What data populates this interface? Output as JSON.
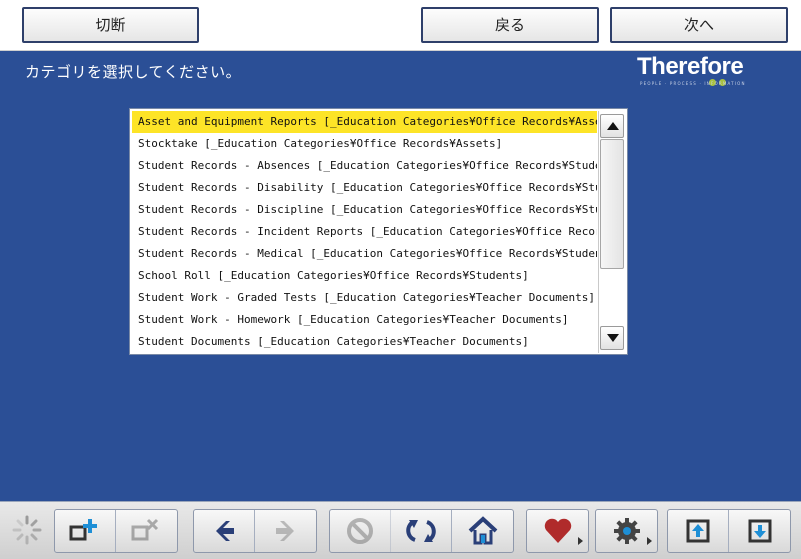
{
  "header": {
    "disconnect_label": "切断",
    "back_label": "戻る",
    "next_label": "次へ"
  },
  "prompt": "カテゴリを選択してください。",
  "logo": {
    "text": "Therefore",
    "tagline": "PEOPLE · PROCESS · INFORMATION"
  },
  "categories": [
    "Asset and Equipment Reports [_Education Categories¥Office Records¥Assets]",
    "Stocktake [_Education Categories¥Office Records¥Assets]",
    "Student Records - Absences [_Education Categories¥Office Records¥Students]",
    "Student Records - Disability [_Education Categories¥Office Records¥Students]",
    "Student Records - Discipline [_Education Categories¥Office Records¥Students]",
    "Student Records - Incident Reports [_Education Categories¥Office Records¥Stu",
    "Student Records - Medical [_Education Categories¥Office Records¥Students]",
    "School Roll [_Education Categories¥Office Records¥Students]",
    "Student Work - Graded Tests [_Education Categories¥Teacher Documents]",
    "Student Work - Homework [_Education Categories¥Teacher Documents]",
    "Student Documents [_Education Categories¥Teacher Documents]"
  ],
  "selected_index": 0,
  "colors": {
    "background": "#2b4f96",
    "selection": "#fde427",
    "logo_dot": "#a9c23f"
  },
  "toolbar_icons": [
    "loading-spinner-icon",
    "add-document-icon",
    "remove-document-icon",
    "back-arrow-icon",
    "forward-arrow-icon",
    "stop-icon",
    "refresh-icon",
    "home-icon",
    "favorites-heart-icon",
    "settings-gear-icon",
    "upload-icon",
    "download-icon"
  ]
}
